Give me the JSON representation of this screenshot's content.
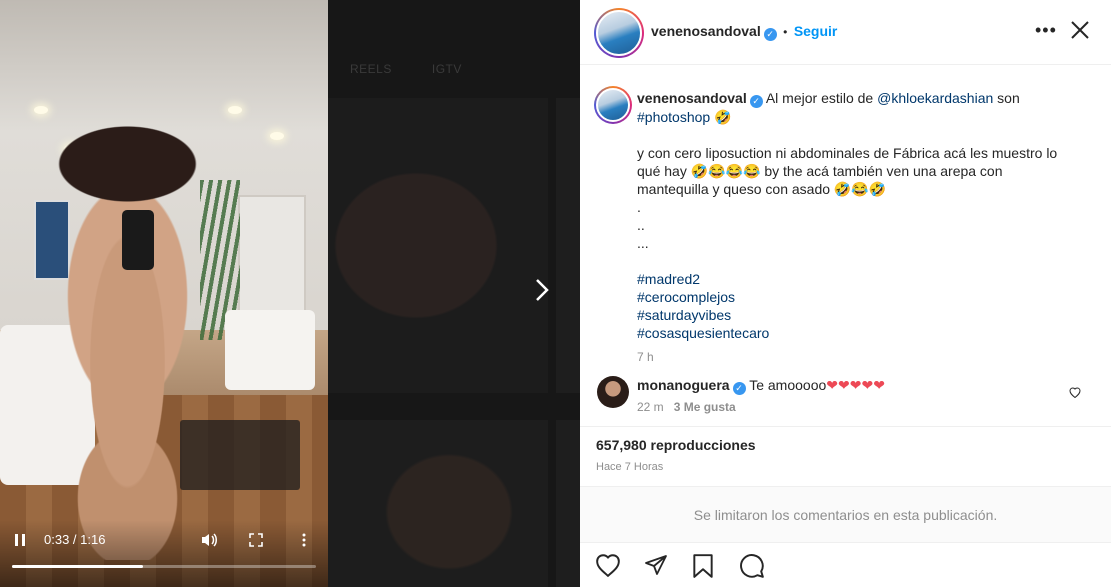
{
  "video": {
    "current_time": "0:33",
    "separator": " / ",
    "duration": "1:16",
    "progress": 0.43
  },
  "dim_tabs": [
    "REELS",
    "IGTV"
  ],
  "post": {
    "username": "venenosandoval",
    "follow_label": "Seguir",
    "bullet": "•",
    "caption": {
      "intro": "Al mejor estilo de",
      "mention": "@khloekardashian",
      "intro_tail": "son",
      "hashtag_photoshop": "#photoshop",
      "emoji_1": "🤣",
      "body_line": "y con cero liposuction ni abdominales de Fábrica acá les muestro lo qué hay",
      "body_emojis": "🤣😂😂😂",
      "body_tail": "by the acá también ven una arepa con mantequilla y queso con asado",
      "body_emojis_2": "🤣😂🤣",
      "dot_1": ".",
      "dot_2": "..",
      "dot_3": "...",
      "hashtags": [
        "#madred2",
        "#cerocomplejos",
        "#saturdayvibes",
        "#cosasquesientecaro"
      ],
      "age": "7 h"
    },
    "reply": {
      "username": "monanoguera",
      "text": "Te amooooo",
      "hearts": "❤❤❤❤❤",
      "age": "22 m",
      "likes": "3 Me gusta"
    },
    "views": "657,980 reproducciones",
    "time_ago": "Hace 7 Horas",
    "limited_comments": "Se limitaron los comentarios en esta publicación."
  },
  "colors": {
    "accent_blue": "#0095f6",
    "link_dark": "#00376b",
    "verified": "#3897f0",
    "muted": "#8e8e8e"
  }
}
